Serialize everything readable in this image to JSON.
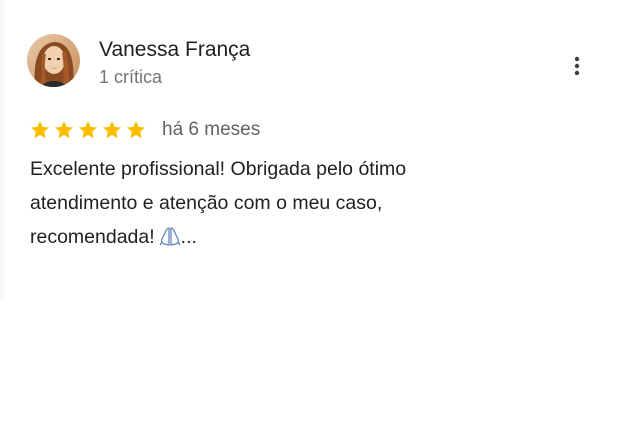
{
  "review": {
    "reviewer_name": "Vanessa França",
    "reviewer_meta": "1 crítica",
    "rating": 5,
    "rating_max": 5,
    "date": "há 6 meses",
    "text": "Excelente profissional! Obrigada pelo ótimo atendimento e atenção com o meu caso, recomendada!",
    "emoji": "folded-hands-icon",
    "more_label": "..."
  },
  "icons": {
    "menu": "more-vert-icon",
    "star": "star-icon"
  },
  "colors": {
    "star": "#fbbc04",
    "name": "#202124",
    "meta": "#70757a"
  }
}
